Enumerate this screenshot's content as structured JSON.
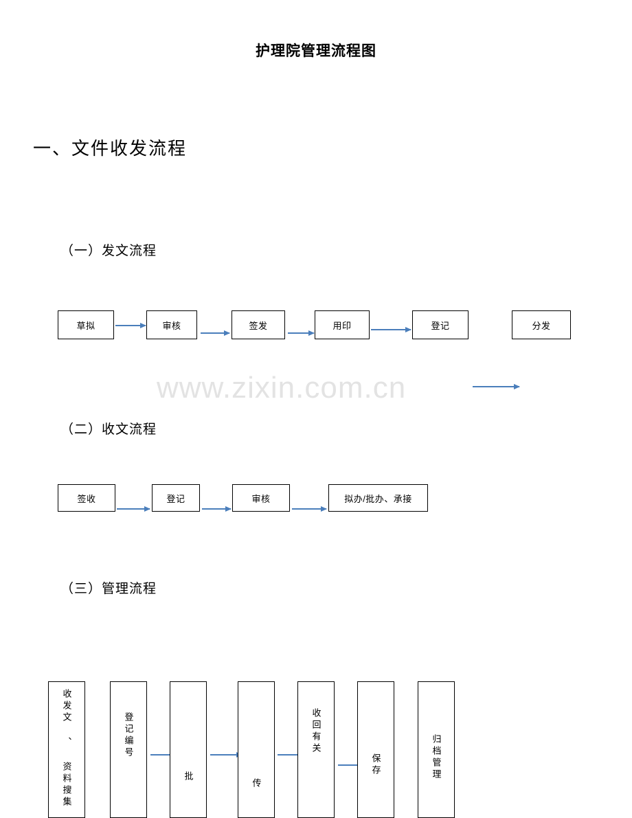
{
  "document": {
    "title": "护理院管理流程图",
    "section_heading": "一、文件收发流程",
    "watermark": "www.zixin.com.cn"
  },
  "subsections": {
    "dispatch": {
      "heading": "（一）发文流程",
      "boxes": [
        {
          "label": "草拟"
        },
        {
          "label": "审核"
        },
        {
          "label": "签发"
        },
        {
          "label": "用印"
        },
        {
          "label": "登记"
        },
        {
          "label": "分发"
        }
      ]
    },
    "receive": {
      "heading": "（二）收文流程",
      "boxes": [
        {
          "label": "签收"
        },
        {
          "label": "登记"
        },
        {
          "label": "审核"
        },
        {
          "label": "拟办/批办、承接"
        }
      ]
    },
    "manage": {
      "heading": "（三）管理流程",
      "boxes": [
        {
          "label": "收发文 、 资料搜集"
        },
        {
          "label": "登记编号"
        },
        {
          "label": "批"
        },
        {
          "label": "传"
        },
        {
          "label": "收回有关"
        },
        {
          "label": "保存"
        },
        {
          "label": "归档管理"
        }
      ]
    }
  },
  "colors": {
    "arrow": "#4a7ebb",
    "box_border": "#000000",
    "watermark": "#e3e3e3"
  }
}
